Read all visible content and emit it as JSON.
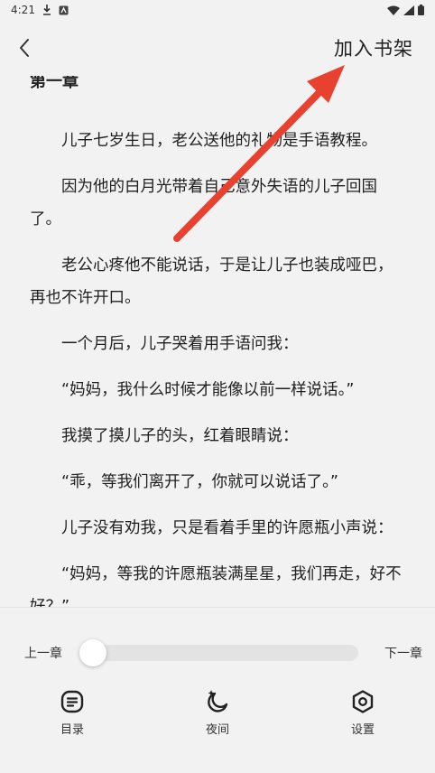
{
  "status_bar": {
    "time": "4:21"
  },
  "header": {
    "add_to_shelf": "加入书架"
  },
  "reader": {
    "chapter_title": "第一章",
    "paragraphs": [
      "儿子七岁生日，老公送他的礼物是手语教程。",
      "因为他的白月光带着自己意外失语的儿子回国了。",
      "老公心疼他不能说话，于是让儿子也装成哑巴，再也不许开口。",
      "一个月后，儿子哭着用手语问我：",
      "“妈妈，我什么时候才能像以前一样说话。”",
      "我摸了摸儿子的头，红着眼睛说：",
      "“乖，等我们离开了，你就可以说话了。”",
      "儿子没有劝我，只是看着手里的许愿瓶小声说：",
      "“妈妈，等我的许愿瓶装满星星，我们再走，好不好？”"
    ]
  },
  "controls": {
    "prev_chapter": "上一章",
    "next_chapter": "下一章",
    "progress_fraction": 0.0
  },
  "toolbar": {
    "catalog": "目录",
    "night": "夜间",
    "settings": "设置"
  },
  "colors": {
    "annotation_arrow": "#e8412f",
    "track": "#e3e3e3",
    "background": "#f2f2f2"
  },
  "icons": {
    "status": [
      "download-icon",
      "notification-icon",
      "wifi-icon",
      "signal-icon",
      "battery-icon"
    ],
    "header": [
      "back-chevron-icon"
    ],
    "toolbar": [
      "catalog-icon",
      "night-mode-icon",
      "settings-icon"
    ]
  }
}
